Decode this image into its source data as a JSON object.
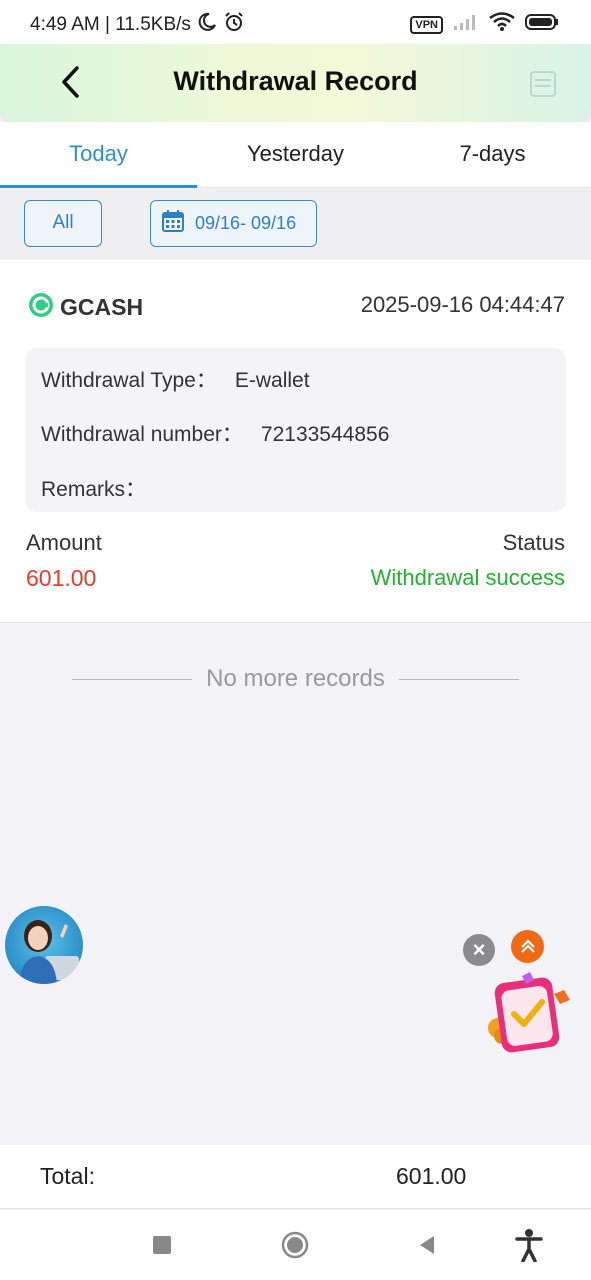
{
  "status_bar": {
    "time_speed": "4:49 AM | 11.5KB/s",
    "vpn": "VPN"
  },
  "header": {
    "title": "Withdrawal Record"
  },
  "tabs": [
    {
      "label": "Today",
      "active": true
    },
    {
      "label": "Yesterday",
      "active": false
    },
    {
      "label": "7-days",
      "active": false
    }
  ],
  "filters": {
    "all_label": "All",
    "date_range": "09/16- 09/16"
  },
  "record": {
    "method": "GCASH",
    "datetime": "2025-09-16 04:44:47",
    "type_label": "Withdrawal Type：",
    "type_value": "E-wallet",
    "number_label": "Withdrawal number：",
    "number_value": "72133544856",
    "remarks_label": "Remarks：",
    "remarks_value": "",
    "amount_label": "Amount",
    "amount_value": "601.00",
    "status_label": "Status",
    "status_value": "Withdrawal success"
  },
  "list_end": "No more records",
  "total": {
    "label": "Total:",
    "value": "601.00"
  },
  "colors": {
    "accent": "#2f8fd2",
    "amount": "#e0402d",
    "success": "#22b232"
  }
}
